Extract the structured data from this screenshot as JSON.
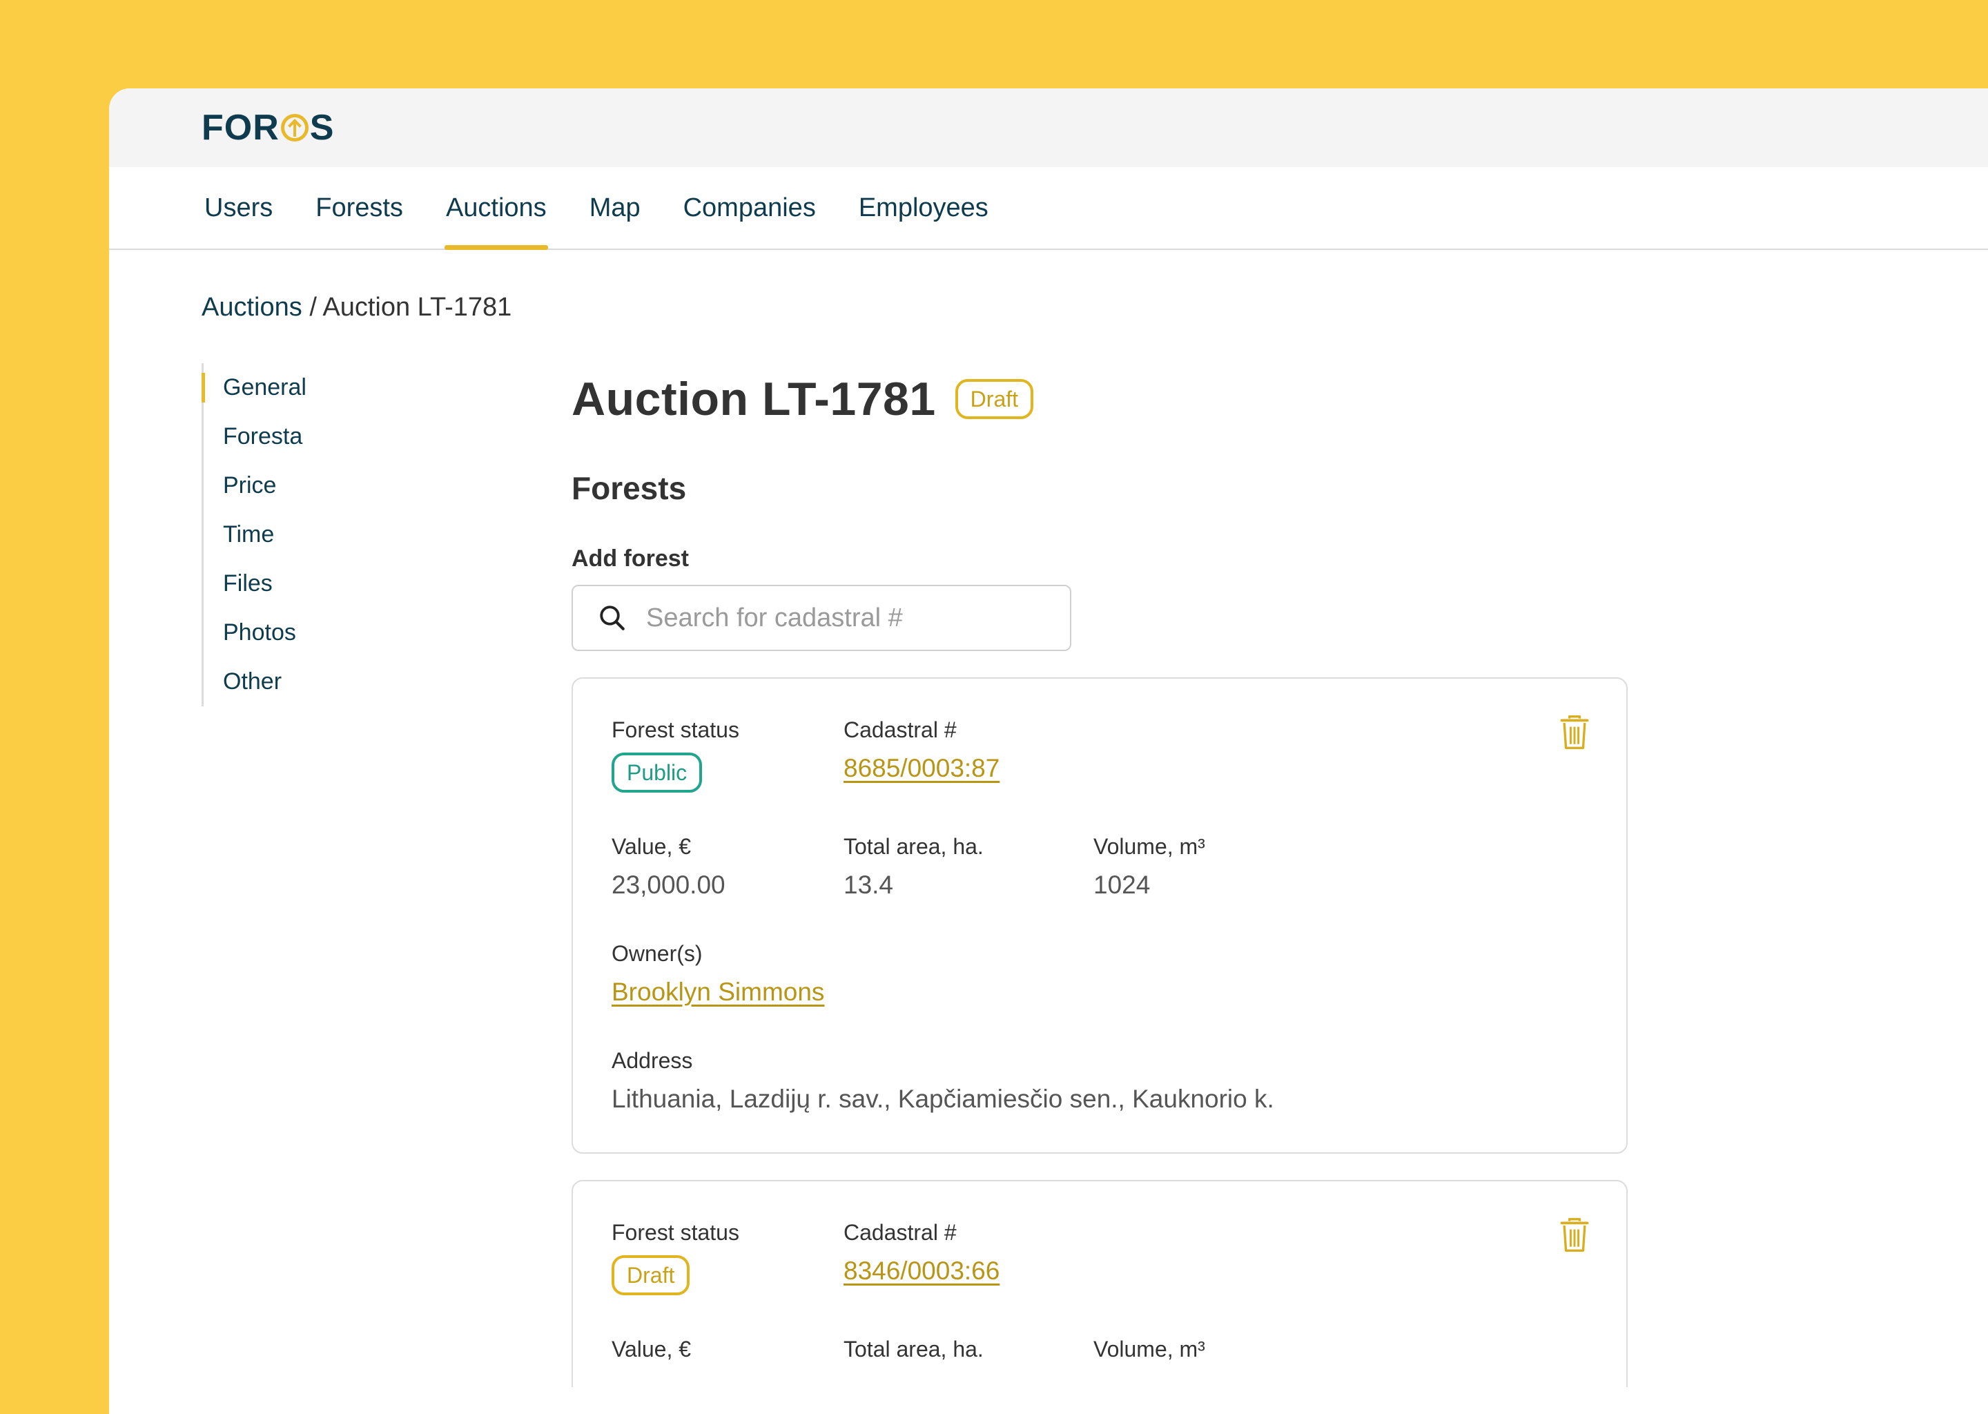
{
  "app": {
    "logo_text_left": "FOR",
    "logo_text_right": "S"
  },
  "nav": {
    "items": [
      {
        "label": "Users"
      },
      {
        "label": "Forests"
      },
      {
        "label": "Auctions",
        "active": true
      },
      {
        "label": "Map"
      },
      {
        "label": "Companies"
      },
      {
        "label": "Employees"
      }
    ]
  },
  "breadcrumb": {
    "parent": "Auctions",
    "separator": "/",
    "current": "Auction LT-1781"
  },
  "sidebar": {
    "items": [
      {
        "label": "General",
        "active": true
      },
      {
        "label": "Foresta"
      },
      {
        "label": "Price"
      },
      {
        "label": "Time"
      },
      {
        "label": "Files"
      },
      {
        "label": "Photos"
      },
      {
        "label": "Other"
      }
    ]
  },
  "page": {
    "title": "Auction LT-1781",
    "status_badge": "Draft",
    "section_title": "Forests",
    "add_forest_label": "Add forest",
    "search_placeholder": "Search for cadastral #"
  },
  "labels": {
    "forest_status": "Forest status",
    "cadastral": "Cadastral #",
    "value": "Value, €",
    "total_area": "Total area, ha.",
    "volume": "Volume, m³",
    "owners": "Owner(s)",
    "address": "Address"
  },
  "forests": [
    {
      "status": "Public",
      "cadastral": "8685/0003:87",
      "value": "23,000.00",
      "total_area": "13.4",
      "volume": "1024",
      "owner": "Brooklyn Simmons",
      "address": "Lithuania, Lazdijų r. sav., Kapčiamiesčio sen., Kauknorio k."
    },
    {
      "status": "Draft",
      "cadastral": "8346/0003:66"
    }
  ],
  "colors": {
    "background": "#FBCD45",
    "accent": "#E8B92B",
    "navy": "#0E3B4D",
    "public_green": "#21A68D",
    "link_gold": "#B89514"
  }
}
